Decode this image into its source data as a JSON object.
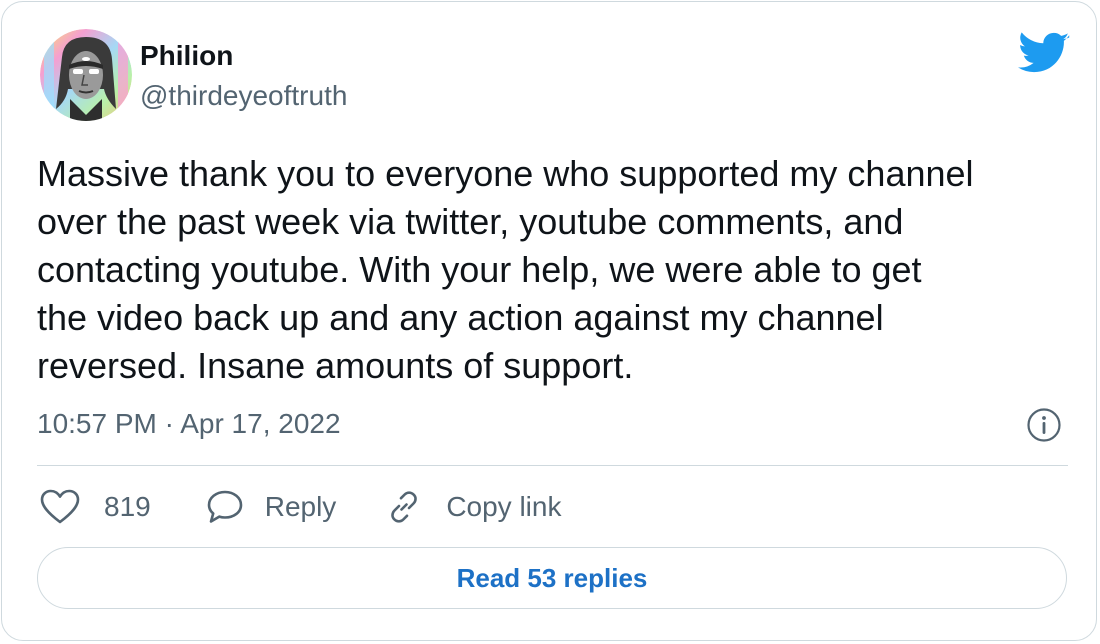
{
  "author": {
    "display_name": "Philion",
    "handle": "@thirdeyeoftruth"
  },
  "tweet": {
    "text": "Massive thank you to everyone who supported my channel\nover the past week via twitter, youtube comments, and\ncontacting youtube. With your help, we were able to get\nthe video back up and any action against my channel\nreversed. Insane amounts of support.",
    "time": "10:57 PM",
    "separator": " · ",
    "date": "Apr 17, 2022"
  },
  "actions": {
    "like_count": "819",
    "reply_label": "Reply",
    "copy_label": "Copy link"
  },
  "footer": {
    "read_replies_label": "Read 53 replies"
  },
  "icons": {
    "brand": "twitter-bird-icon",
    "info": "info-icon",
    "like": "heart-icon",
    "reply": "speech-bubble-icon",
    "copy": "link-icon"
  },
  "colors": {
    "brand_blue": "#1d9bf0",
    "link_blue": "#1d71c6",
    "text_primary": "#0f1419",
    "text_secondary": "#536471",
    "border": "#cfd9de"
  }
}
